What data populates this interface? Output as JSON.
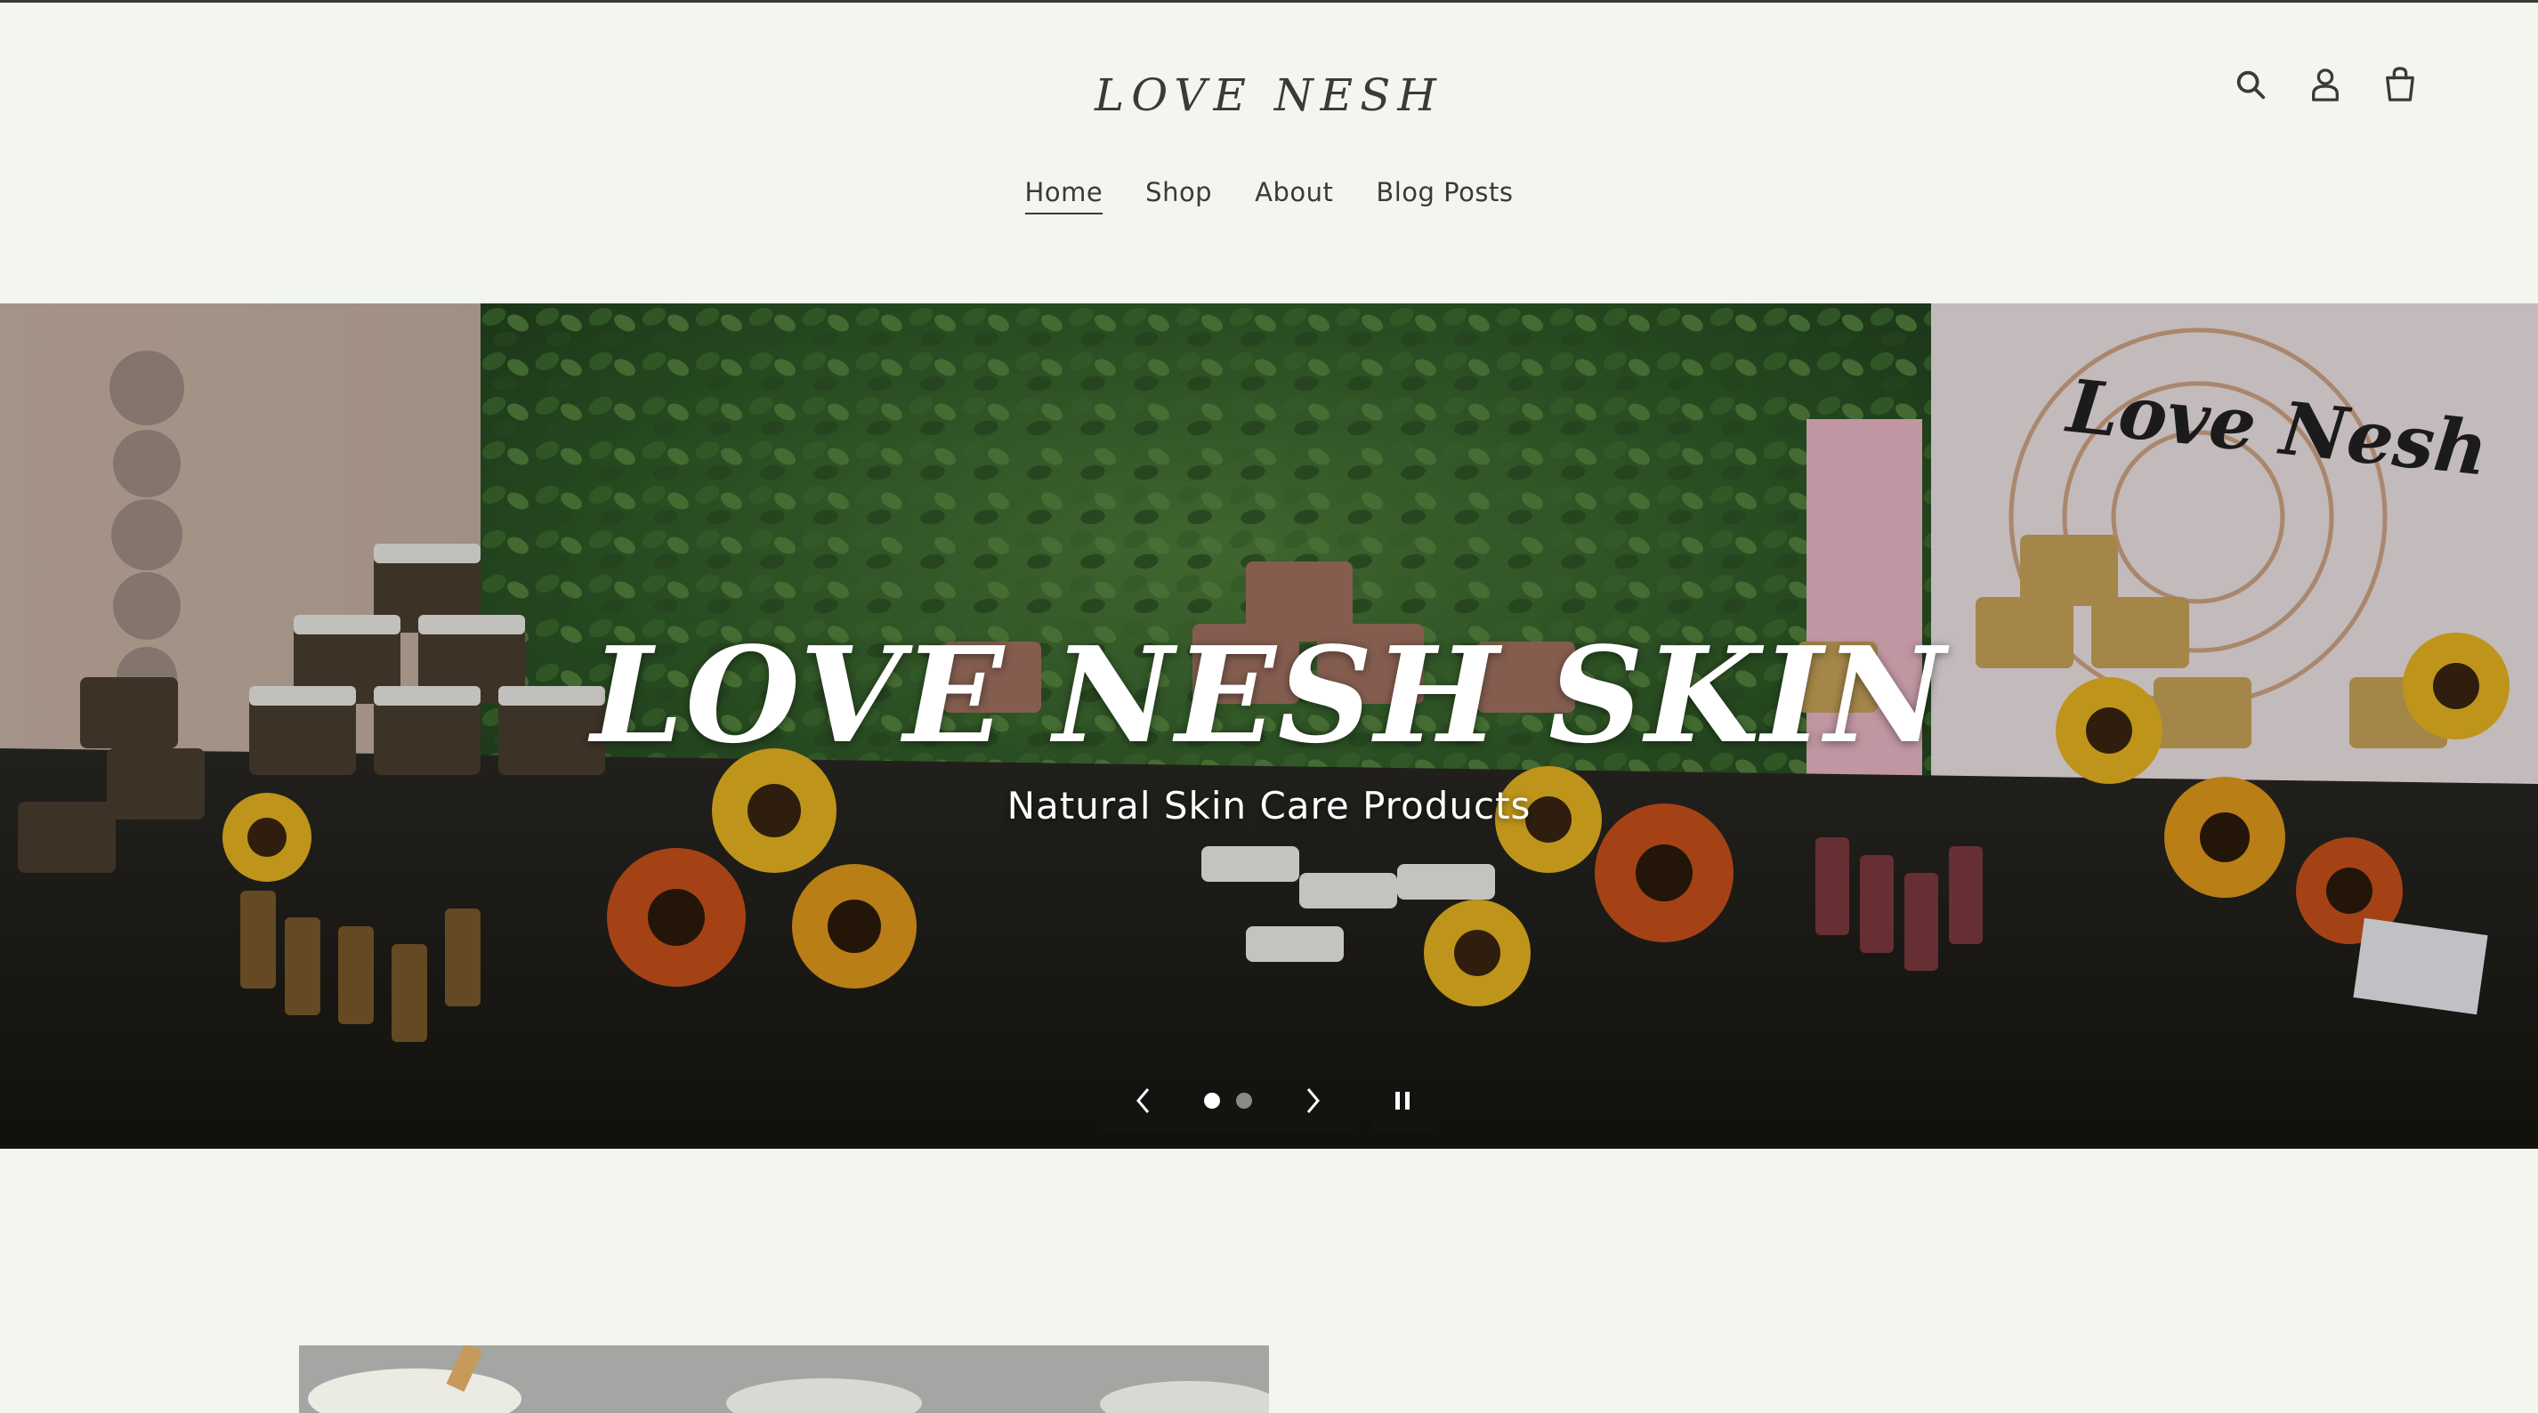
{
  "brand": {
    "logo_text": "LOVE NESH"
  },
  "header": {
    "icons": [
      "search-icon",
      "account-icon",
      "cart-icon"
    ],
    "nav": [
      {
        "label": "Home",
        "active": true
      },
      {
        "label": "Shop",
        "active": false
      },
      {
        "label": "About",
        "active": false
      },
      {
        "label": "Blog Posts",
        "active": false
      }
    ]
  },
  "hero": {
    "heading": "LOVE NESH SKIN",
    "subheading": "Natural Skin Care Products",
    "image_sign_text": "Love Nesh",
    "slides_total": 2,
    "active_slide": 1,
    "controls": {
      "prev_icon": "chevron-left-icon",
      "next_icon": "chevron-right-icon",
      "pause_icon": "pause-icon"
    }
  },
  "colors": {
    "background": "#f3f5ef",
    "text": "#3a3a3a",
    "hero_text": "#ffffff",
    "controls_bg": "rgba(20,20,20,0.55)"
  }
}
